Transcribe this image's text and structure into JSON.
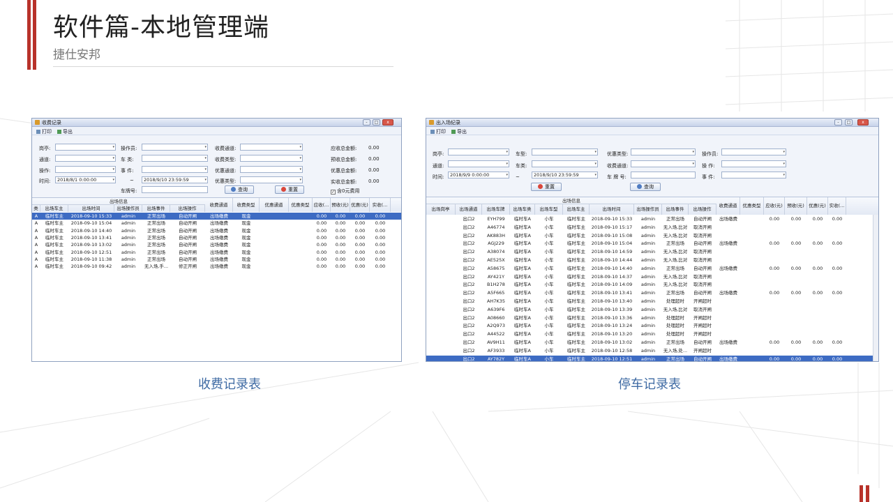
{
  "slide": {
    "title": "软件篇-本地管理端",
    "subtitle": "捷仕安邦",
    "caption_left": "收费记录表",
    "caption_right": "停车记录表"
  },
  "colors": {
    "accent": "#b8322a",
    "caption": "#3e6aa3",
    "selection": "#3d6bc3"
  },
  "fee_window": {
    "title": "收费记录",
    "window_buttons": {
      "minimize": "-",
      "maximize": "□",
      "close": "x"
    },
    "toolbar": {
      "print": "打印",
      "export": "导出"
    },
    "filters": {
      "l_gate": "岗亭:",
      "l_channel": "通道:",
      "l_operation": "操作:",
      "l_time": "时间:",
      "time_from": "2018/8/1 0:00:00",
      "time_to": "2018/9/10 23:59:59",
      "tilde": "~",
      "l_operator": "操作员:",
      "l_vehicle_class": "车 类:",
      "l_event": "事 件:",
      "l_plate": "车牌号:",
      "l_fee_channel": "收费通道:",
      "l_fee_type": "收费类型:",
      "l_discount_channel": "优惠通道:",
      "l_discount_type": "优惠类型:",
      "l_total_due": "应收总金额:",
      "l_total_prepaid": "预收总金额:",
      "l_total_discount": "优惠总金额:",
      "l_total_actual": "实收总金额:",
      "total_due": "0.00",
      "total_prepaid": "0.00",
      "total_discount": "0.00",
      "total_actual": "0.00",
      "btn_query": "查询",
      "btn_reset": "重置",
      "chk_zero": "含0元费用",
      "chk_mark": "✓"
    },
    "group_header": "出场信息",
    "columns": [
      "类",
      "出场车主",
      "出场时间",
      "出场操作员",
      "出场事件",
      "出场操作",
      "收费通道",
      "收费类型",
      "优惠通道",
      "优惠类型",
      "应收(...",
      "预收(元)",
      "优惠(元)",
      "实收(..."
    ],
    "rows": [
      [
        "A",
        "临时车主",
        "2018-09-10 15:33",
        "admin",
        "正常出场",
        "自动开闸",
        "出场缴费",
        "现金",
        "",
        "",
        "0.00",
        "0.00",
        "0.00",
        "0.00"
      ],
      [
        "A",
        "临时车主",
        "2018-09-10 15:04",
        "admin",
        "正常出场",
        "自动开闸",
        "出场缴费",
        "现金",
        "",
        "",
        "0.00",
        "0.00",
        "0.00",
        "0.00"
      ],
      [
        "A",
        "临时车主",
        "2018-09-10 14:40",
        "admin",
        "正常出场",
        "自动开闸",
        "出场缴费",
        "现金",
        "",
        "",
        "0.00",
        "0.00",
        "0.00",
        "0.00"
      ],
      [
        "A",
        "临时车主",
        "2018-09-10 13:41",
        "admin",
        "正常出场",
        "自动开闸",
        "出场缴费",
        "现金",
        "",
        "",
        "0.00",
        "0.00",
        "0.00",
        "0.00"
      ],
      [
        "A",
        "临时车主",
        "2018-09-10 13:02",
        "admin",
        "正常出场",
        "自动开闸",
        "出场缴费",
        "现金",
        "",
        "",
        "0.00",
        "0.00",
        "0.00",
        "0.00"
      ],
      [
        "A",
        "临时车主",
        "2018-09-10 12:51",
        "admin",
        "正常出场",
        "自动开闸",
        "出场缴费",
        "现金",
        "",
        "",
        "0.00",
        "0.00",
        "0.00",
        "0.00"
      ],
      [
        "A",
        "临时车主",
        "2018-09-10 11:38",
        "admin",
        "正常出场",
        "自动开闸",
        "出场缴费",
        "现金",
        "",
        "",
        "0.00",
        "0.00",
        "0.00",
        "0.00"
      ],
      [
        "A",
        "临时车主",
        "2018-09-10 09:42",
        "admin",
        "无入场,手...",
        "修正开闸",
        "出场缴费",
        "现金",
        "",
        "",
        "0.00",
        "0.00",
        "0.00",
        "0.00"
      ]
    ]
  },
  "park_window": {
    "title": "出入场纪录",
    "window_buttons": {
      "minimize": "-",
      "maximize": "□",
      "close": "x"
    },
    "toolbar": {
      "print": "打印",
      "export": "导出"
    },
    "filters": {
      "l_gate": "岗亭:",
      "l_channel": "通道:",
      "l_time": "时间:",
      "time_from": "2018/9/9 0:00:00",
      "time_to": "2018/9/10 23:59:59",
      "tilde": "~",
      "l_vehicle_type": "车型:",
      "l_vehicle_class": "车类:",
      "l_discount_type": "优惠类型:",
      "l_fee_channel": "收费通道:",
      "l_plate": "车 牌 号:",
      "l_operator": "操作员:",
      "l_operation": "操 作:",
      "l_event": "事 件:",
      "btn_reset": "重置",
      "btn_query": "查询"
    },
    "group_header": "出场信息",
    "columns": [
      "出场岗亭",
      "出场通道",
      "出场车牌",
      "出场车类",
      "出场车型",
      "出场车主",
      "出场时间",
      "出场操作员",
      "出场事件",
      "出场操作",
      "收费通道",
      "优惠类型",
      "应收(元)",
      "预收(元)",
      "优惠(元)",
      "实收(..."
    ],
    "rows": [
      [
        "",
        "出口2",
        "EYH799",
        "临时车A",
        "小车",
        "临时车主",
        "2018-09-10 15:33",
        "admin",
        "正常出场",
        "自动开闸",
        "出场缴费",
        "",
        "0.00",
        "0.00",
        "0.00",
        "0.00"
      ],
      [
        "",
        "出口2",
        "A46774",
        "临时车A",
        "小车",
        "临时车主",
        "2018-09-10 15:17",
        "admin",
        "无入场,比对",
        "取消开闸",
        "",
        "",
        "",
        "",
        "",
        ""
      ],
      [
        "",
        "出口2",
        "AK883H",
        "临时车A",
        "小车",
        "临时车主",
        "2018-09-10 15:08",
        "admin",
        "无入场,比对",
        "取消开闸",
        "",
        "",
        "",
        "",
        "",
        ""
      ],
      [
        "",
        "出口2",
        "AGJ229",
        "临时车A",
        "小车",
        "临时车主",
        "2018-09-10 15:04",
        "admin",
        "正常出场",
        "自动开闸",
        "出场缴费",
        "",
        "0.00",
        "0.00",
        "0.00",
        "0.00"
      ],
      [
        "",
        "出口2",
        "A38074",
        "临时车A",
        "小车",
        "临时车主",
        "2018-09-10 14:59",
        "admin",
        "无入场,比对",
        "取消开闸",
        "",
        "",
        "",
        "",
        "",
        ""
      ],
      [
        "",
        "出口2",
        "AE525X",
        "临时车A",
        "小车",
        "临时车主",
        "2018-09-10 14:44",
        "admin",
        "无入场,比对",
        "取消开闸",
        "",
        "",
        "",
        "",
        "",
        ""
      ],
      [
        "",
        "出口2",
        "A58675",
        "临时车A",
        "小车",
        "临时车主",
        "2018-09-10 14:40",
        "admin",
        "正常出场",
        "自动开闸",
        "出场缴费",
        "",
        "0.00",
        "0.00",
        "0.00",
        "0.00"
      ],
      [
        "",
        "出口2",
        "AY421Y",
        "临时车A",
        "小车",
        "临时车主",
        "2018-09-10 14:37",
        "admin",
        "无入场,比对",
        "取消开闸",
        "",
        "",
        "",
        "",
        "",
        ""
      ],
      [
        "",
        "出口2",
        "B1H278",
        "临时车A",
        "小车",
        "临时车主",
        "2018-09-10 14:09",
        "admin",
        "无入场,比对",
        "取消开闸",
        "",
        "",
        "",
        "",
        "",
        ""
      ],
      [
        "",
        "出口2",
        "A5F665",
        "临时车A",
        "小车",
        "临时车主",
        "2018-09-10 13:41",
        "admin",
        "正常出场",
        "自动开闸",
        "出场缴费",
        "",
        "0.00",
        "0.00",
        "0.00",
        "0.00"
      ],
      [
        "",
        "出口2",
        "AH7K35",
        "临时车A",
        "小车",
        "临时车主",
        "2018-09-10 13:40",
        "admin",
        "处理超时",
        "开闸超时",
        "",
        "",
        "",
        "",
        "",
        ""
      ],
      [
        "",
        "出口2",
        "A639F6",
        "临时车A",
        "小车",
        "临时车主",
        "2018-09-10 13:39",
        "admin",
        "无入场,比对",
        "取消开闸",
        "",
        "",
        "",
        "",
        "",
        ""
      ],
      [
        "",
        "出口2",
        "A08660",
        "临时车A",
        "小车",
        "临时车主",
        "2018-09-10 13:36",
        "admin",
        "处理超时",
        "开闸超时",
        "",
        "",
        "",
        "",
        "",
        ""
      ],
      [
        "",
        "出口2",
        "A2Q973",
        "临时车A",
        "小车",
        "临时车主",
        "2018-09-10 13:24",
        "admin",
        "处理超时",
        "开闸超时",
        "",
        "",
        "",
        "",
        "",
        ""
      ],
      [
        "",
        "出口2",
        "A44522",
        "临时车A",
        "小车",
        "临时车主",
        "2018-09-10 13:20",
        "admin",
        "处理超时",
        "开闸超时",
        "",
        "",
        "",
        "",
        "",
        ""
      ],
      [
        "",
        "出口2",
        "AV9H11",
        "临时车A",
        "小车",
        "临时车主",
        "2018-09-10 13:02",
        "admin",
        "正常出场",
        "自动开闸",
        "出场缴费",
        "",
        "0.00",
        "0.00",
        "0.00",
        "0.00"
      ],
      [
        "",
        "出口2",
        "AF3933",
        "临时车A",
        "小车",
        "临时车主",
        "2018-09-10 12:58",
        "admin",
        "无入场,处...",
        "开闸超时",
        "",
        "",
        "",
        "",
        "",
        ""
      ],
      [
        "",
        "出口2",
        "AY782Y",
        "临时车A",
        "小车",
        "临时车主",
        "2018-09-10 12:51",
        "admin",
        "正常出场",
        "自动开闸",
        "出场缴费",
        "",
        "0.00",
        "0.00",
        "0.00",
        "0.00"
      ]
    ]
  }
}
